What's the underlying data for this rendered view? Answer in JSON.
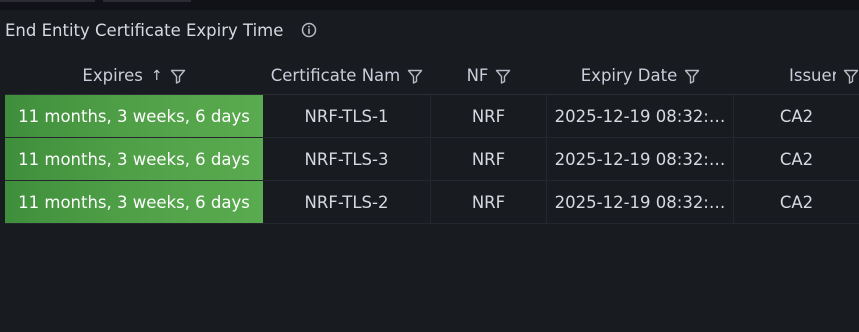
{
  "panel": {
    "title": "End Entity Certificate Expiry Time"
  },
  "table": {
    "columns": [
      {
        "label": "Expires",
        "sorted": "ascending",
        "sort_indicator": "↑"
      },
      {
        "label": "Certificate Nam"
      },
      {
        "label": "NF"
      },
      {
        "label": "Expiry Date"
      },
      {
        "label": "Issuer"
      }
    ],
    "rows": [
      {
        "expires": "11 months, 3 weeks, 6 days",
        "certificate": "NRF-TLS-1",
        "nf": "NRF",
        "expiry_date": "2025-12-19 08:32:…",
        "issuer": "CA2"
      },
      {
        "expires": "11 months, 3 weeks, 6 days",
        "certificate": "NRF-TLS-3",
        "nf": "NRF",
        "expiry_date": "2025-12-19 08:32:…",
        "issuer": "CA2"
      },
      {
        "expires": "11 months, 3 weeks, 6 days",
        "certificate": "NRF-TLS-2",
        "nf": "NRF",
        "expiry_date": "2025-12-19 08:32:…",
        "issuer": "CA2"
      }
    ]
  },
  "colors": {
    "background": "#181b1f",
    "expires_cell": "#52a34a",
    "text": "#ccccdc"
  },
  "icons": {
    "info": "info-icon",
    "filter": "filter-icon",
    "sort": "sort-ascending-icon"
  }
}
